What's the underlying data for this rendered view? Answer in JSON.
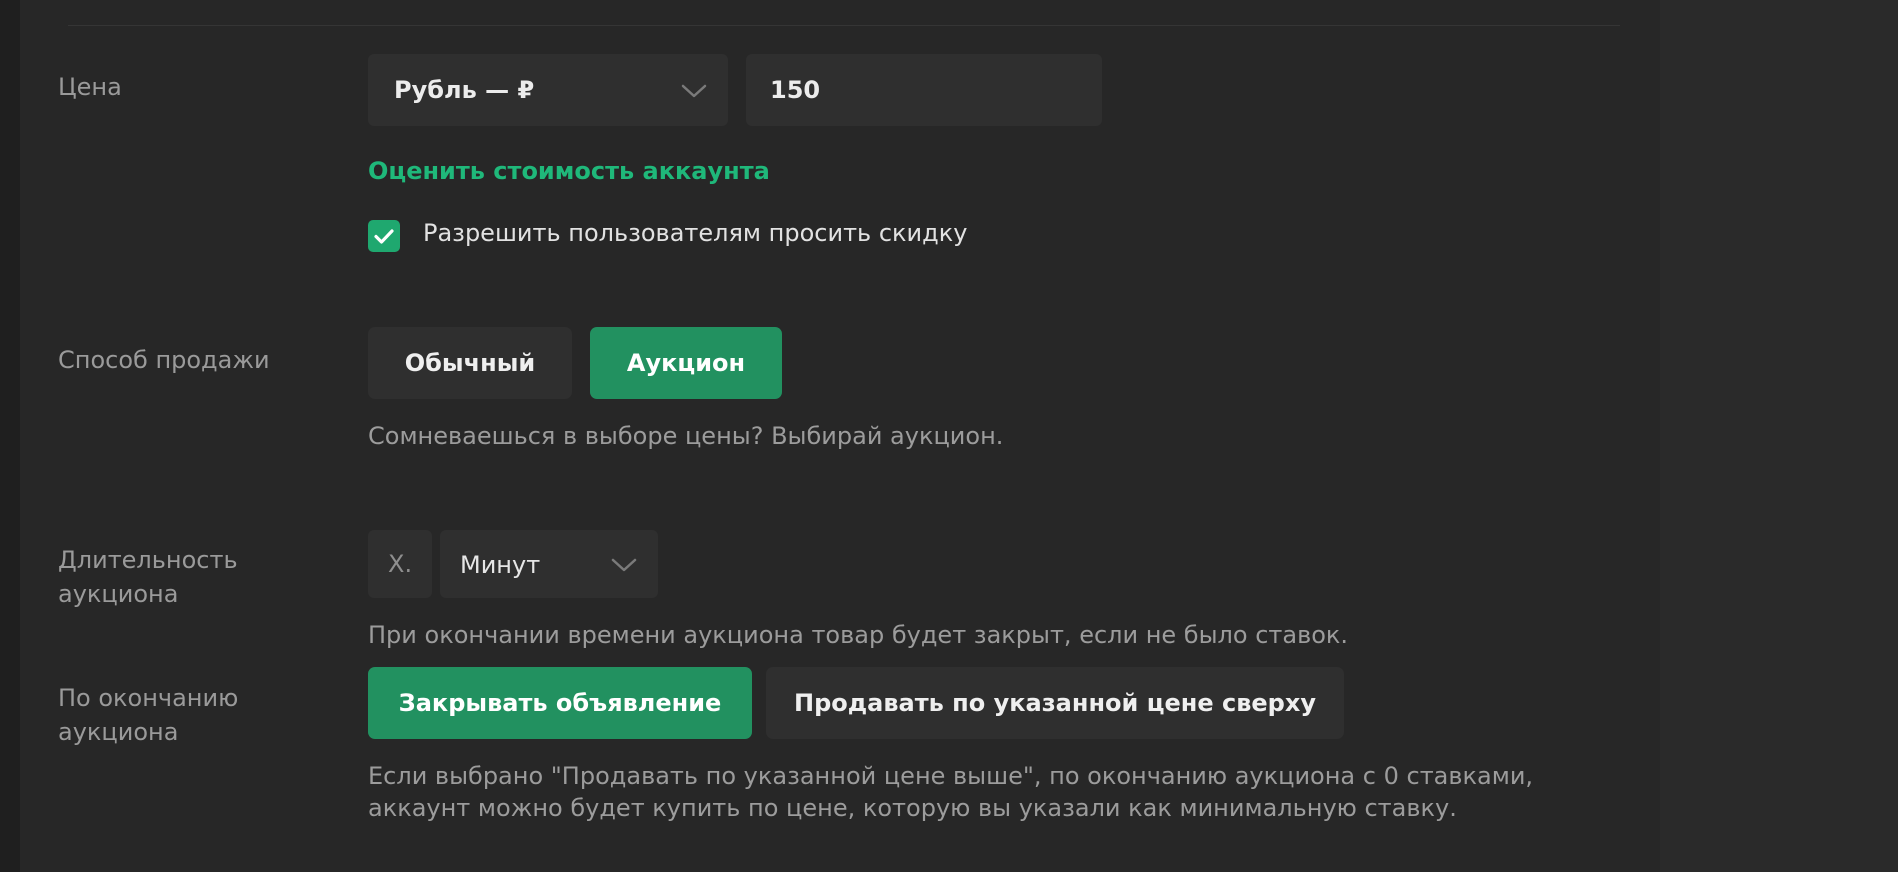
{
  "price": {
    "label": "Цена",
    "currency_value": "Рубль — ₽",
    "amount_value": "150",
    "estimate_link": "Оценить стоимость аккаунта",
    "discount_checkbox_label": "Разрешить пользователям просить скидку",
    "discount_checked": true
  },
  "sale_method": {
    "label": "Способ продажи",
    "options": [
      "Обычный",
      "Аукцион"
    ],
    "selected": "Аукцион",
    "hint": "Сомневаешься в выборе цены? Выбирай аукцион."
  },
  "duration": {
    "label_line1": "Длительность",
    "label_line2": "аукциона",
    "prefix": "X.",
    "unit_value": "Минут",
    "hint": "При окончании времени аукциона товар будет закрыт, если не было ставок."
  },
  "on_end": {
    "label_line1": "По окончанию",
    "label_line2": "аукциона",
    "options": [
      "Закрывать объявление",
      "Продавать по указанной цене сверху"
    ],
    "selected": "Закрывать объявление",
    "hint_line1": "Если выбрано \"Продавать по указанной цене выше\", по окончанию аукциона с 0 ставками,",
    "hint_line2": "аккаунт можно будет купить по цене, которую вы указали как минимальную ставку."
  },
  "colors": {
    "accent": "#229160",
    "link": "#1fb87a",
    "panel": "#272727",
    "field": "#2f2f2f"
  },
  "icons": [
    "chevron-down-icon",
    "checkmark-icon"
  ]
}
